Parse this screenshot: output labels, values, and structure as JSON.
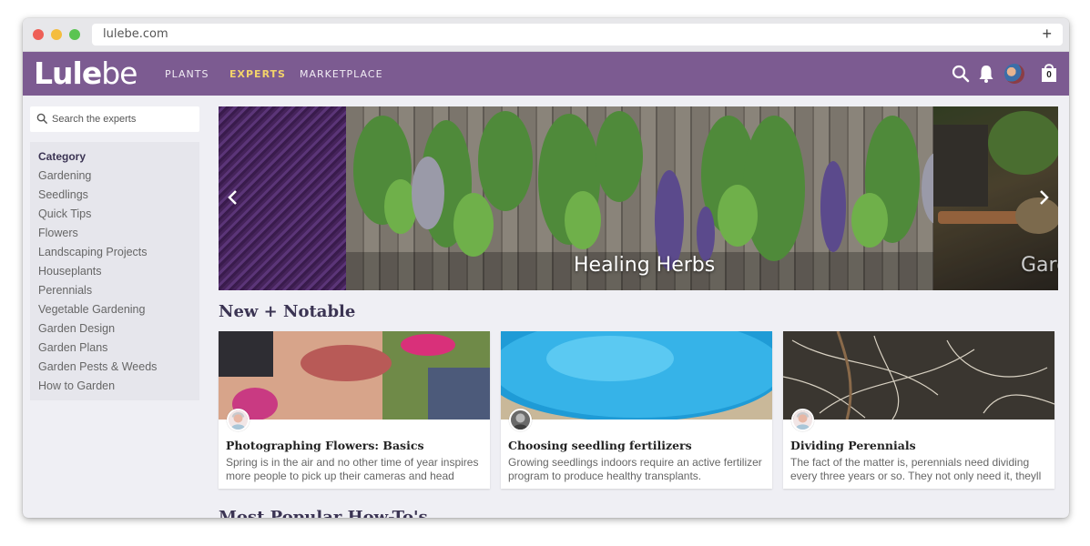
{
  "browser": {
    "url": "lulebe.com",
    "new_tab": "+"
  },
  "brand": {
    "logo_bold": "Lule",
    "logo_light": "be"
  },
  "nav": {
    "links": [
      "PLANTS",
      "EXPERTS",
      "MARKETPLACE"
    ],
    "active": "EXPERTS",
    "cart_count": "0"
  },
  "sidebar": {
    "search_placeholder": "Search the experts",
    "category_title": "Category",
    "categories": [
      "Gardening",
      "Seedlings",
      "Quick Tips",
      "Flowers",
      "Landscaping Projects",
      "Houseplants",
      "Perennials",
      "Vegetable Gardening",
      "Garden Design",
      "Garden Plans",
      "Garden Pests & Weeds",
      "How to Garden"
    ]
  },
  "carousel": {
    "captions": [
      "Healing Herbs",
      "Gard"
    ]
  },
  "sections": {
    "new_notable": "New + Notable",
    "most_popular": "Most Popular How-To's"
  },
  "cards": [
    {
      "title": "Photographing Flowers: Basics",
      "text": "Spring is in the air and no other time of year inspires more people to pick up their cameras and head"
    },
    {
      "title": "Choosing seedling fertilizers",
      "text": "Growing seedlings indoors require an active fertilizer program to produce healthy transplants."
    },
    {
      "title": "Dividing Perennials",
      "text": "The fact of the matter is, perennials need dividing every three years or so. They not only need it, theyll thrive as"
    }
  ],
  "colors": {
    "navbar": "#7c5b91",
    "active_nav": "#f3d36a",
    "heading": "#3b3453"
  }
}
